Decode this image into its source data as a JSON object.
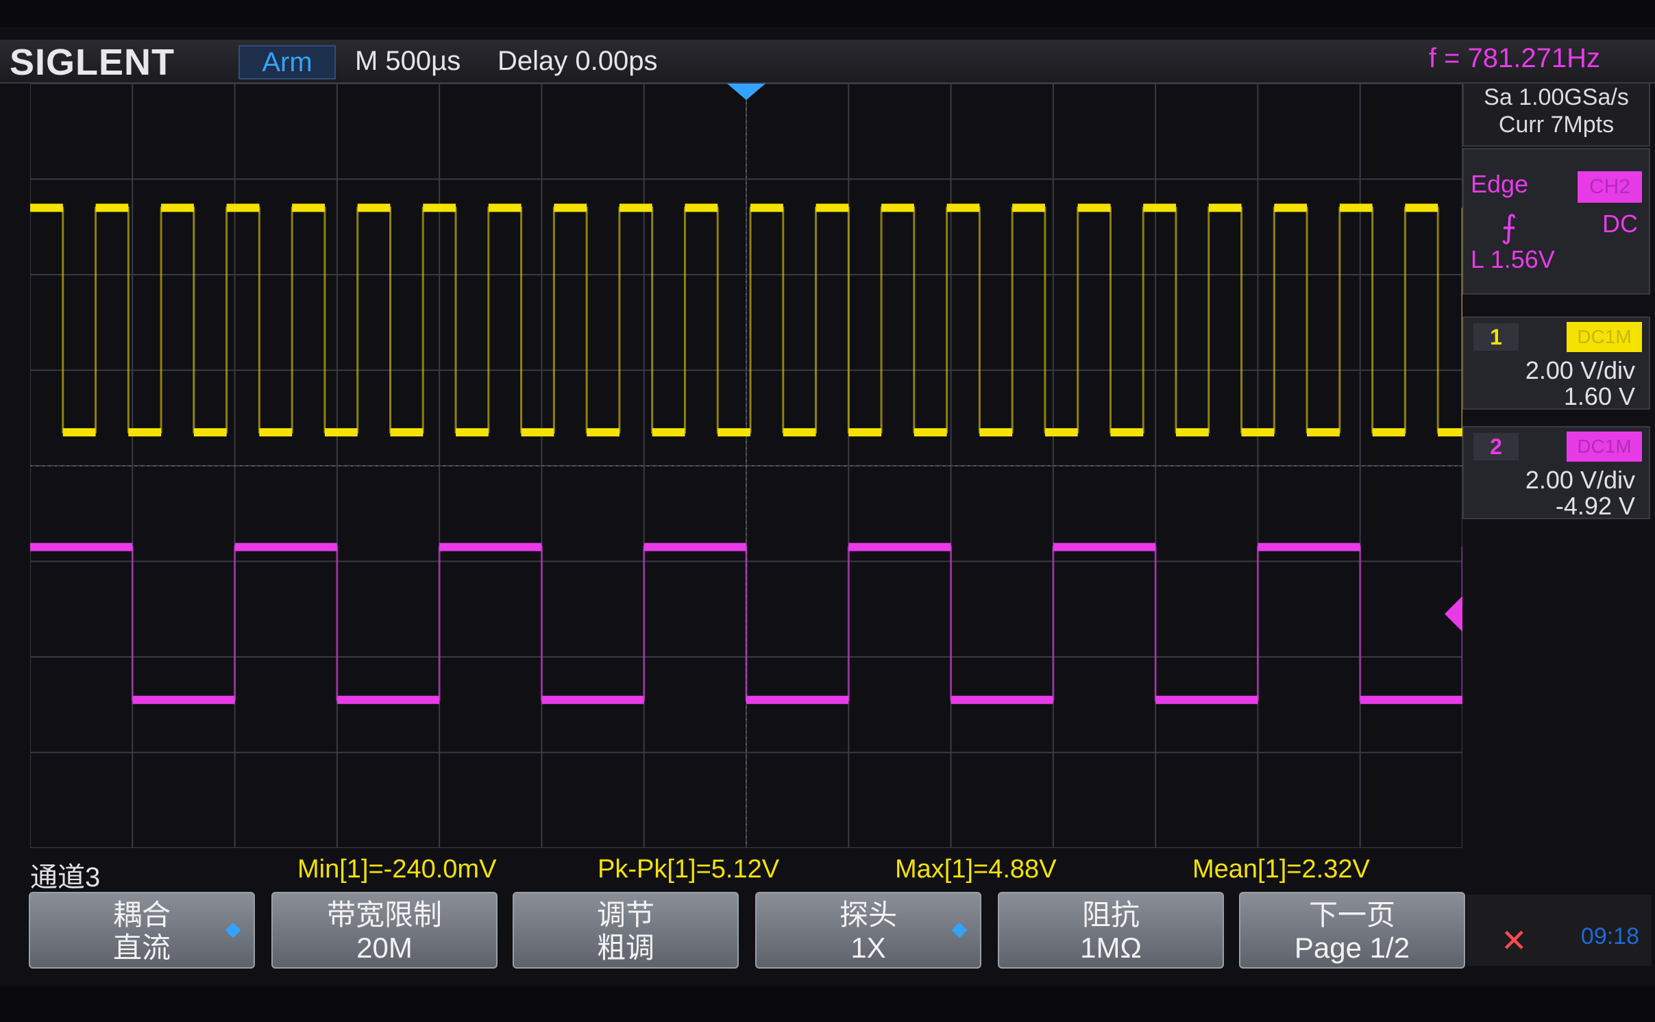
{
  "header": {
    "brand": "SIGLENT",
    "trigger_status": "Arm",
    "timebase": "M 500µs",
    "delay": "Delay 0.00ps",
    "frequency": "f = 781.271Hz"
  },
  "acquisition": {
    "sample_rate": "Sa 1.00GSa/s",
    "memory_depth": "Curr 7Mpts"
  },
  "trigger": {
    "type": "Edge",
    "source": "CH2",
    "slope_icon": "rising-edge-icon",
    "coupling": "DC",
    "level": "L  1.56V"
  },
  "channels": [
    {
      "number": "1",
      "coupling": "DC1M",
      "vdiv": "2.00 V/div",
      "offset": "1.60 V",
      "color": "#f5e200"
    },
    {
      "number": "2",
      "coupling": "DC1M",
      "vdiv": "2.00 V/div",
      "offset": "-4.92 V",
      "color": "#e83be8"
    }
  ],
  "measurements": {
    "channel_label": "通道3",
    "min": "Min[1]=-240.0mV",
    "pkpk": "Pk-Pk[1]=5.12V",
    "max": "Max[1]=4.88V",
    "mean": "Mean[1]=2.32V"
  },
  "softkeys": [
    {
      "line1": "耦合",
      "line2": "直流",
      "has_knob": true
    },
    {
      "line1": "带宽限制",
      "line2": "20M",
      "has_knob": false
    },
    {
      "line1": "调节",
      "line2": "粗调",
      "has_knob": false
    },
    {
      "line1": "探头",
      "line2": "1X",
      "has_knob": true
    },
    {
      "line1": "阻抗",
      "line2": "1MΩ",
      "has_knob": false
    },
    {
      "line1": "下一页",
      "line2": "Page 1/2",
      "has_knob": false
    }
  ],
  "status": {
    "usb_icon": "usb-icon",
    "clock": "09:18"
  },
  "colors": {
    "ch1": "#f5e200",
    "ch2": "#e83be8",
    "accent": "#33a3ff",
    "grid": "#3a3a44"
  },
  "waveforms": {
    "ch1": {
      "period_div": 0.64,
      "duty": 0.5,
      "high_div": 1.3,
      "low_div": 3.65
    },
    "ch2": {
      "period_div": 2.0,
      "duty": 0.5,
      "high_div": 4.85,
      "low_div": 6.45
    }
  }
}
